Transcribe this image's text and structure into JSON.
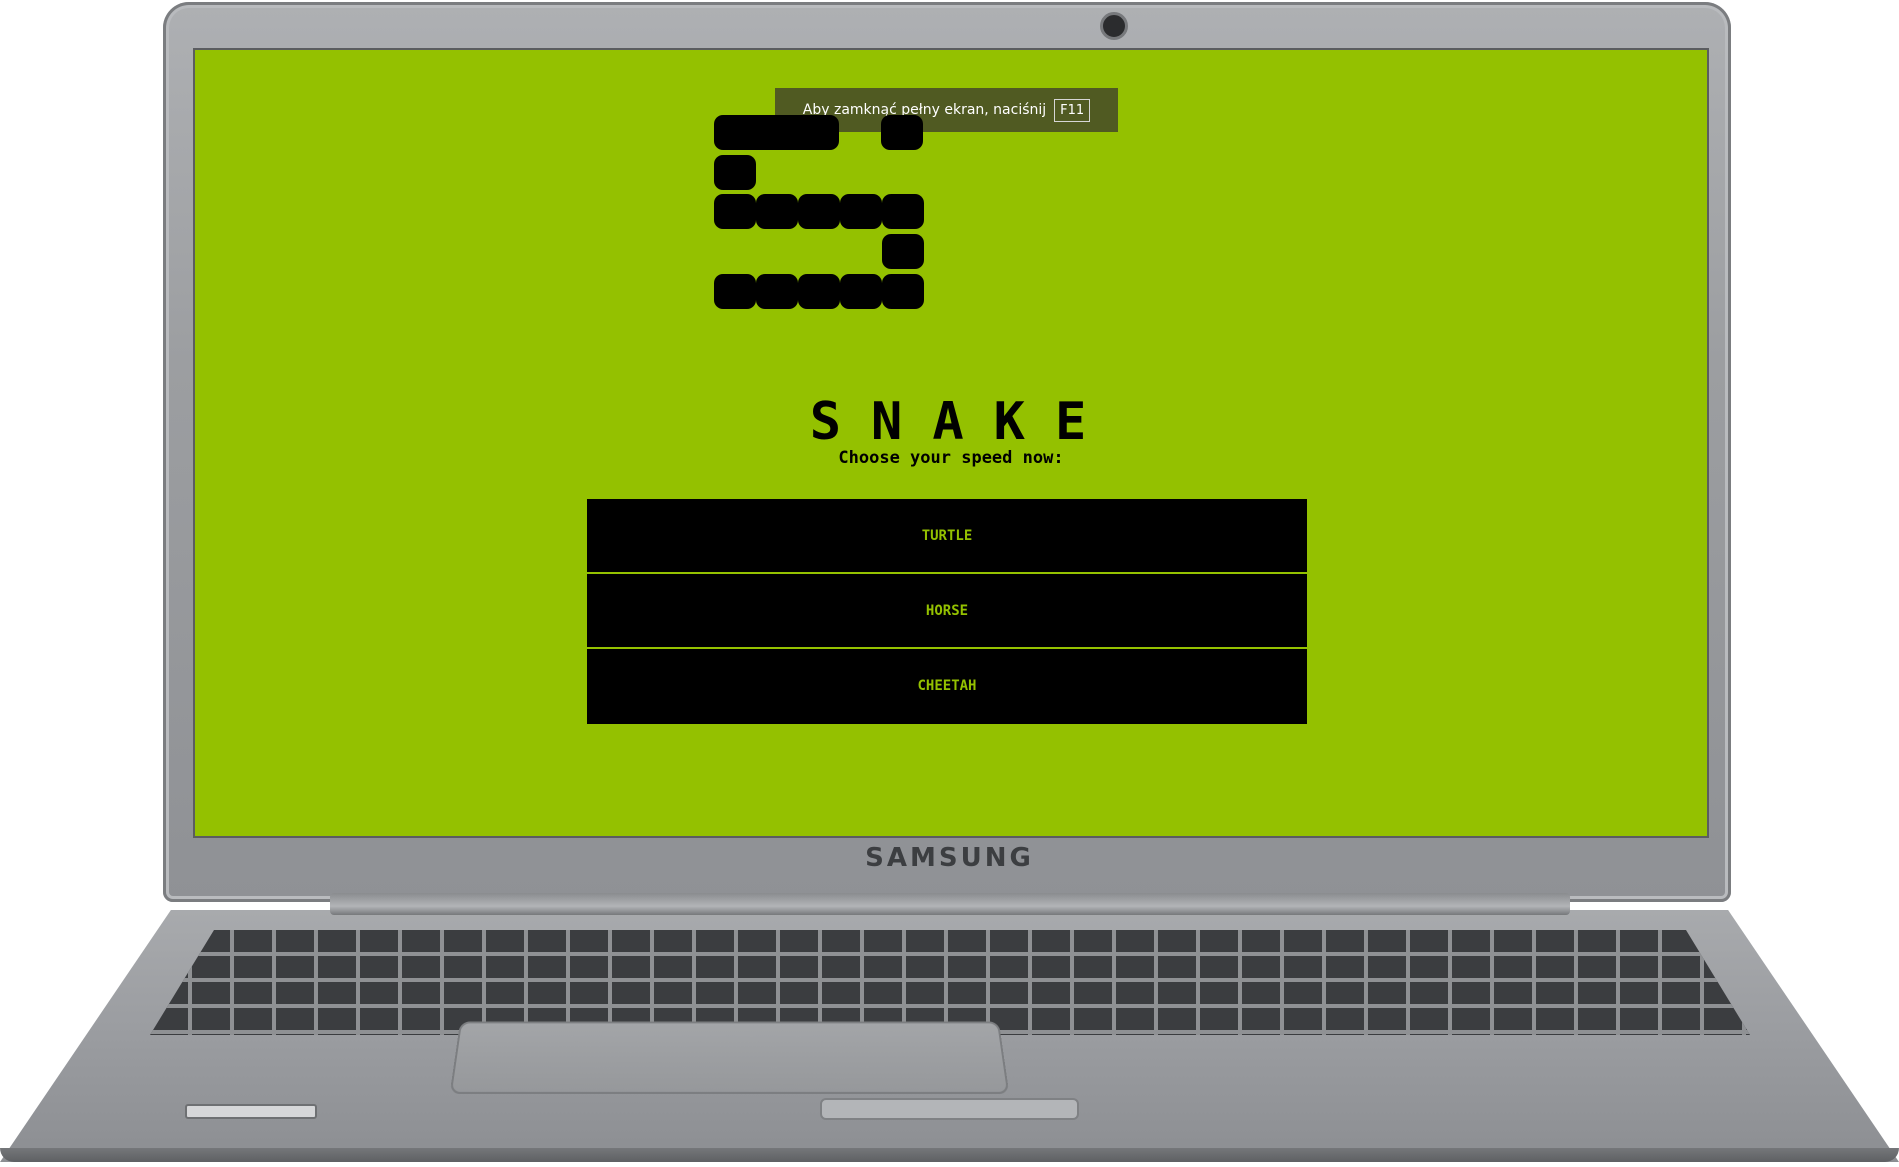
{
  "device": {
    "brand": "SAMSUNG"
  },
  "fullscreen_notice": {
    "text": "Aby zamknąć pełny ekran, naciśnij",
    "key": "F11"
  },
  "game": {
    "title": "SNAKE",
    "prompt": "Choose your speed now:",
    "speed_options": [
      "TURTLE",
      "HORSE",
      "CHEETAH"
    ],
    "colors": {
      "background": "#94c100",
      "button_bg": "#000000",
      "button_text": "#94c100"
    }
  }
}
